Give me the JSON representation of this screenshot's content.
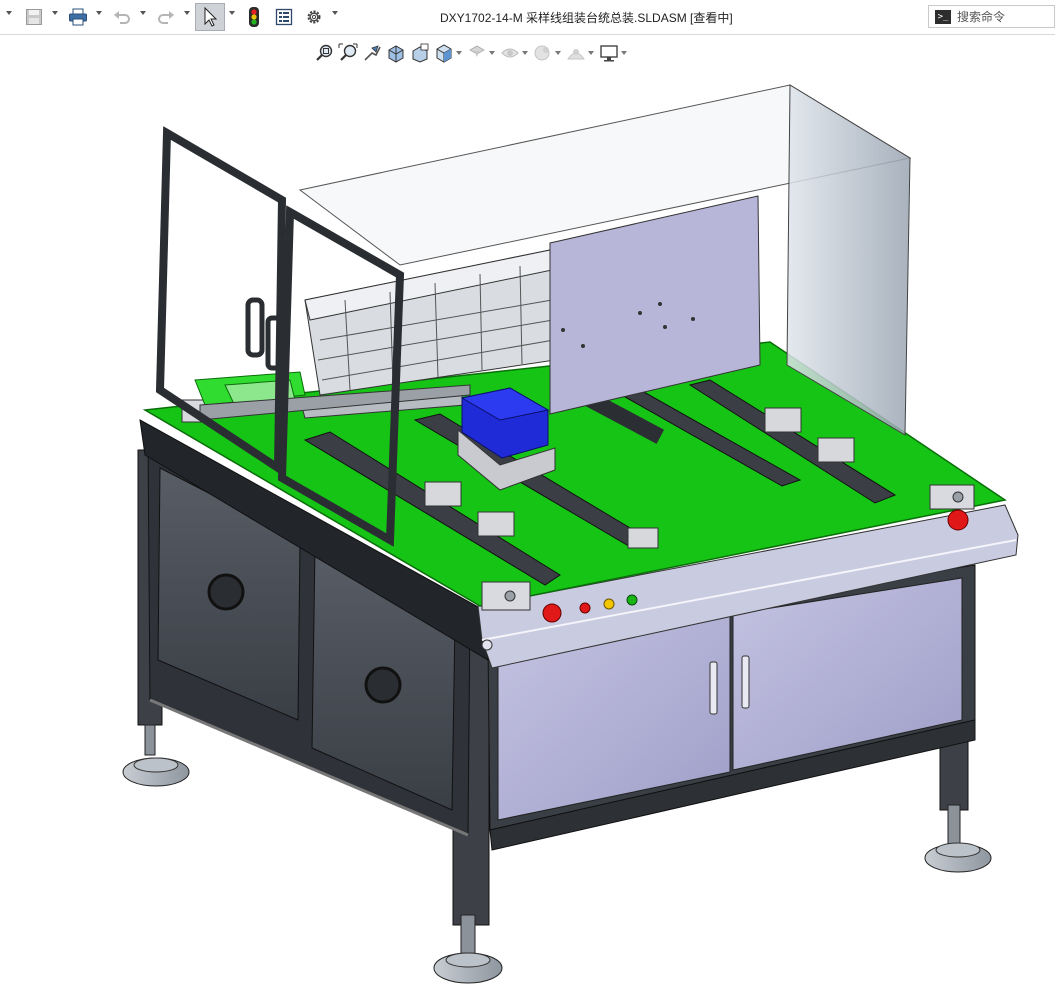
{
  "app": {
    "document_title": "DXY1702-14-M 采样线组装台统总装.SLDASM [查看中]"
  },
  "quick_access": {
    "items": [
      {
        "name": "new-menu-arrow",
        "icon": "chevron-down-icon"
      },
      {
        "name": "save",
        "icon": "save-icon"
      },
      {
        "name": "print",
        "icon": "print-icon"
      },
      {
        "name": "undo",
        "icon": "undo-icon"
      },
      {
        "name": "redo",
        "icon": "redo-icon"
      },
      {
        "name": "select",
        "icon": "cursor-icon",
        "state": "active"
      },
      {
        "name": "rebuild",
        "icon": "traffic-light-icon"
      },
      {
        "name": "file-properties",
        "icon": "file-properties-icon"
      },
      {
        "name": "options",
        "icon": "gear-icon"
      }
    ]
  },
  "search": {
    "placeholder": "搜索命令"
  },
  "view_toolbar": {
    "items": [
      {
        "name": "zoom-to-fit",
        "icon": "zoom-fit-icon"
      },
      {
        "name": "zoom-to-area",
        "icon": "zoom-area-icon"
      },
      {
        "name": "previous-view",
        "icon": "previous-view-icon"
      },
      {
        "name": "section-view",
        "icon": "section-view-icon"
      },
      {
        "name": "dynamic-annotation",
        "icon": "dynamic-annotation-icon"
      },
      {
        "name": "view-orientation",
        "icon": "view-cube-icon"
      },
      {
        "name": "display-style",
        "icon": "display-style-icon"
      },
      {
        "name": "hide-show-items",
        "icon": "eye-icon"
      },
      {
        "name": "edit-appearance",
        "icon": "appearance-icon"
      },
      {
        "name": "apply-scene",
        "icon": "scene-icon"
      },
      {
        "name": "view-settings",
        "icon": "monitor-icon"
      }
    ]
  },
  "colors": {
    "table_top": "#16c416",
    "frame": "#3d4147",
    "cabinet_door": "#b4b3d6",
    "side_panel": "#4a4f57",
    "glass": "#c9d3dc",
    "bin": "#1f2bd6",
    "red_button": "#e01818",
    "yellow_button": "#f3c600",
    "green_button": "#18b418"
  }
}
